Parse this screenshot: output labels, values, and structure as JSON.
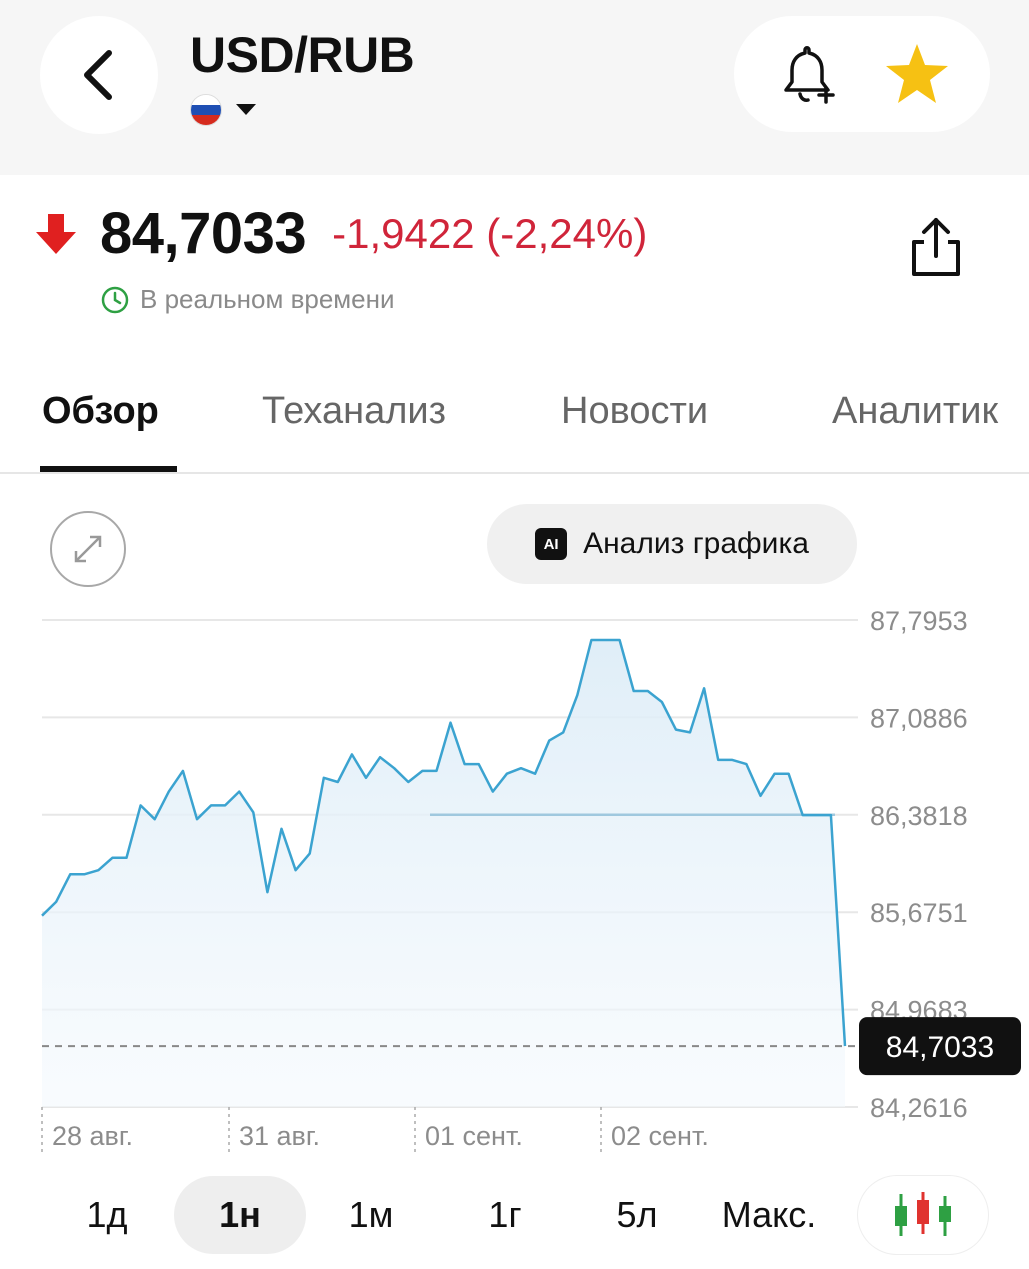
{
  "header": {
    "title": "USD/RUB",
    "flag_colors": [
      "#ffffff",
      "#1f4fb4",
      "#d52b1e"
    ]
  },
  "quote": {
    "price": "84,7033",
    "change": "-1,9422 (-2,24%)",
    "direction": "down",
    "down_color": "#e02020",
    "change_color": "#d0253a",
    "realtime_label": "В реальном времени"
  },
  "tabs": [
    {
      "label": "Обзор",
      "active": true
    },
    {
      "label": "Теханализ",
      "active": false
    },
    {
      "label": "Новости",
      "active": false
    },
    {
      "label": "Аналитик",
      "active": false
    }
  ],
  "chart_controls": {
    "analysis_label": "Анализ графика",
    "ai_badge": "AI"
  },
  "chart_data": {
    "type": "area",
    "line_color": "#3ba3d0",
    "y_ticks": [
      87.7953,
      87.0886,
      86.3818,
      85.6751,
      84.9683,
      84.2616
    ],
    "y_tick_labels": [
      "87,7953",
      "87,0886",
      "86,3818",
      "85,6751",
      "84,9683",
      "84,2616"
    ],
    "ylim": [
      84.2616,
      87.7953
    ],
    "x_labels": [
      "28 авг.",
      "31 авг.",
      "01 сент.",
      "02 сент."
    ],
    "last_price_label": "84,7033",
    "last_price": 84.7033,
    "previous_close": 86.3818,
    "series": [
      {
        "values": [
          85.65,
          85.75,
          85.95,
          85.95,
          85.98,
          86.07,
          86.07,
          86.45,
          86.35,
          86.55,
          86.7,
          86.35,
          86.45,
          86.45,
          86.55,
          86.4,
          85.82,
          86.28,
          85.98,
          86.1,
          86.65,
          86.62,
          86.82,
          86.65,
          86.8,
          86.72,
          86.62,
          86.7,
          86.7,
          87.05,
          86.75,
          86.75,
          86.55,
          86.68,
          86.72,
          86.68,
          86.92,
          86.98,
          87.25,
          87.65,
          87.65,
          87.65,
          87.28,
          87.28,
          87.2,
          87.0,
          86.98,
          87.3,
          86.78,
          86.78,
          86.75,
          86.52,
          86.68,
          86.68,
          86.38,
          86.38,
          86.38,
          84.7033
        ]
      }
    ]
  },
  "timeframes": [
    {
      "label": "1д",
      "active": false
    },
    {
      "label": "1н",
      "active": true
    },
    {
      "label": "1м",
      "active": false
    },
    {
      "label": "1г",
      "active": false
    },
    {
      "label": "5л",
      "active": false
    },
    {
      "label": "Макс.",
      "active": false
    }
  ],
  "candle_colors": [
    "#2ea043",
    "#e0332f"
  ]
}
